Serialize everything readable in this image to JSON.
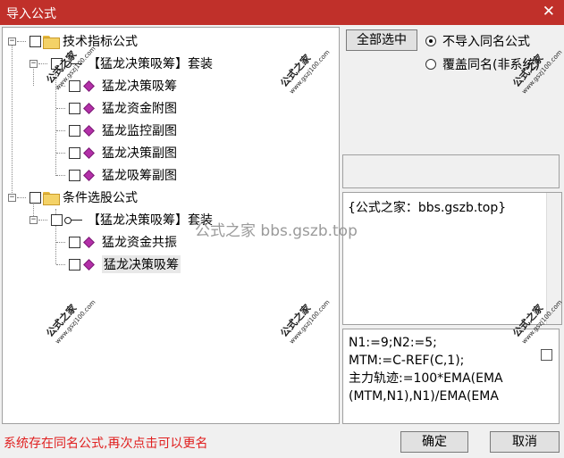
{
  "window": {
    "title": "导入公式",
    "close_glyph": "✕"
  },
  "tree": {
    "nodes": [
      {
        "label": "技术指标公式"
      },
      {
        "label": "【猛龙决策吸筹】套装"
      },
      {
        "label": "猛龙决策吸筹"
      },
      {
        "label": "猛龙资金附图"
      },
      {
        "label": "猛龙监控副图"
      },
      {
        "label": "猛龙决策副图"
      },
      {
        "label": "猛龙吸筹副图"
      },
      {
        "label": "条件选股公式"
      },
      {
        "label": "【猛龙决策吸筹】套装"
      },
      {
        "label": "猛龙资金共振"
      },
      {
        "label": "猛龙决策吸筹"
      }
    ],
    "expander_glyph": "−"
  },
  "options": {
    "select_all_label": "全部选中",
    "radio_skip_label": "不导入同名公式",
    "radio_overwrite_label": "覆盖同名(非系统)",
    "selected": "skip"
  },
  "description": {
    "text": "{公式之家：bbs.gszb.top}"
  },
  "code": {
    "lines": [
      "N1:=9;N2:=5;",
      "MTM:=C-REF(C,1);",
      "主力轨迹:=100*EMA(EMA",
      "(MTM,N1),N1)/EMA(EMA"
    ]
  },
  "footer": {
    "status": "系统存在同名公式,再次点击可以更名",
    "ok_label": "确定",
    "cancel_label": "取消"
  },
  "watermarks": {
    "brand": "公式之家",
    "url": "www.gszj100.com",
    "overlay": "公式之家 bbs.gszb.top"
  },
  "colors": {
    "title_bar": "#c0302a",
    "status_text": "#e02020",
    "gem": "#b32fa8"
  }
}
